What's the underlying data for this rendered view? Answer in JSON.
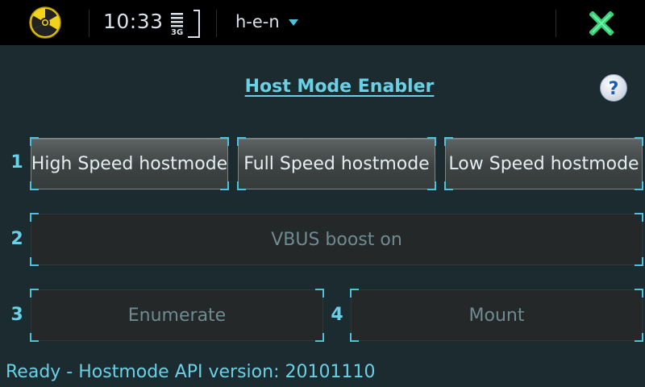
{
  "statusbar": {
    "app_icon": "radiation-icon",
    "time": "10:33",
    "network": "3G",
    "app_title": "h-e-n",
    "close_icon": "close-icon",
    "accent_close": "#3ad07a"
  },
  "main": {
    "title": "Host Mode Enabler",
    "help_icon": "help-icon",
    "rows": [
      {
        "number": "1",
        "buttons": [
          "High Speed hostmode",
          "Full Speed hostmode",
          "Low Speed hostmode"
        ]
      },
      {
        "number": "2",
        "buttons": [
          "VBUS boost on"
        ]
      },
      {
        "number": "3",
        "buttons": [
          "Enumerate"
        ]
      },
      {
        "number": "4",
        "buttons": [
          "Mount"
        ]
      }
    ],
    "status": "Ready - Hostmode API version: 20101110"
  },
  "colors": {
    "background": "#1b2b30",
    "accent": "#6ad0e6",
    "disabled_text": "#6f8b92"
  }
}
